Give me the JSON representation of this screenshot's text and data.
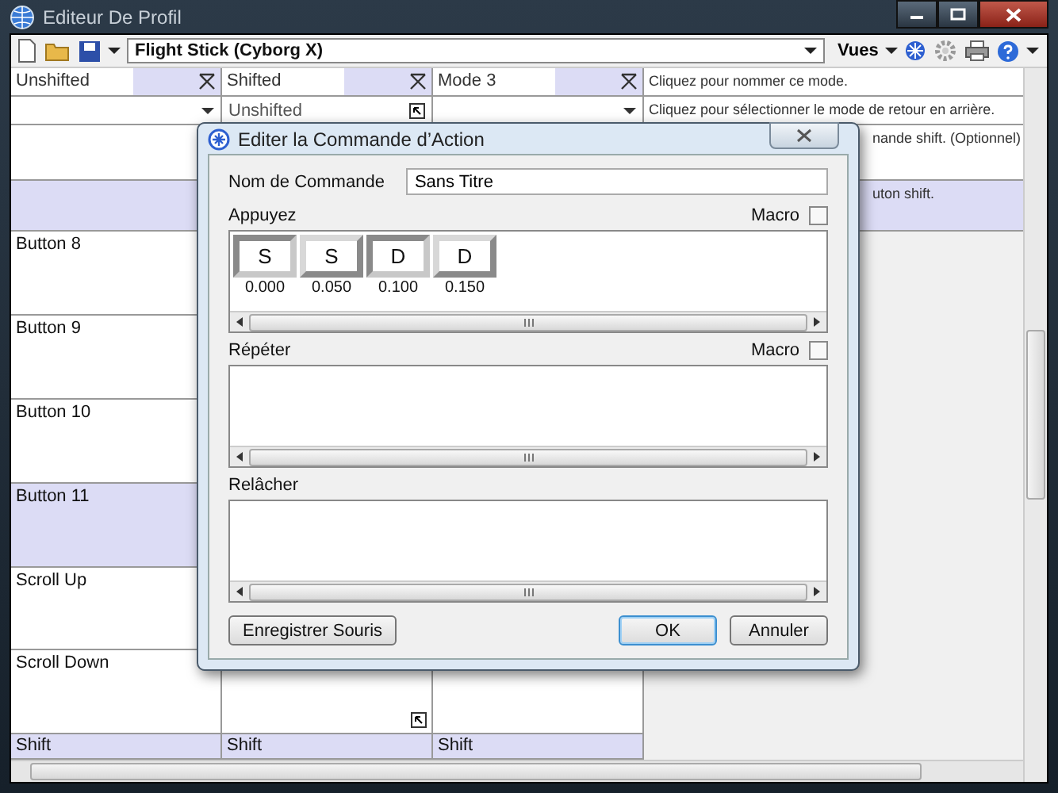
{
  "window": {
    "title": "Editeur De Profil"
  },
  "toolbar": {
    "profile": "Flight Stick (Cyborg X)",
    "views_menu": "Vues"
  },
  "columns": [
    {
      "name": "Unshifted"
    },
    {
      "name": "Shifted",
      "return_mode": "Unshifted"
    },
    {
      "name": "Mode 3"
    }
  ],
  "descriptions": [
    "Cliquez pour nommer ce mode.",
    "Cliquez pour sélectionner le mode de retour en arrière.",
    "nande shift. (Optionnel)",
    "uton shift."
  ],
  "rows": [
    {
      "selected": false
    },
    {
      "selected": true
    },
    {
      "label": "Button 8",
      "selected": false
    },
    {
      "label": "Button 9",
      "selected": false
    },
    {
      "label": "Button 10",
      "selected": false
    },
    {
      "label": "Button 11",
      "selected": true
    },
    {
      "label": "Scroll Up",
      "selected": false
    },
    {
      "label": "Scroll Down",
      "selected": false,
      "link_icon": true
    }
  ],
  "shift_row": [
    "Shift",
    "Shift",
    "Shift"
  ],
  "dialog": {
    "title": "Editer la Commande d’Action",
    "name_label": "Nom de Commande",
    "name_value": "Sans Titre",
    "sections": [
      {
        "title": "Appuyez",
        "macro_label": "Macro",
        "macro_checked": false,
        "keys": [
          {
            "key": "S",
            "time": "0.000",
            "kind": "down"
          },
          {
            "key": "S",
            "time": "0.050",
            "kind": "up"
          },
          {
            "key": "D",
            "time": "0.100",
            "kind": "down"
          },
          {
            "key": "D",
            "time": "0.150",
            "kind": "up"
          }
        ]
      },
      {
        "title": "Répéter",
        "macro_label": "Macro",
        "macro_checked": false
      },
      {
        "title": "Relâcher"
      }
    ],
    "record_button": "Enregistrer Souris",
    "buttons": [
      {
        "label": "OK",
        "default": true
      },
      {
        "label": "Annuler",
        "default": false
      }
    ]
  }
}
